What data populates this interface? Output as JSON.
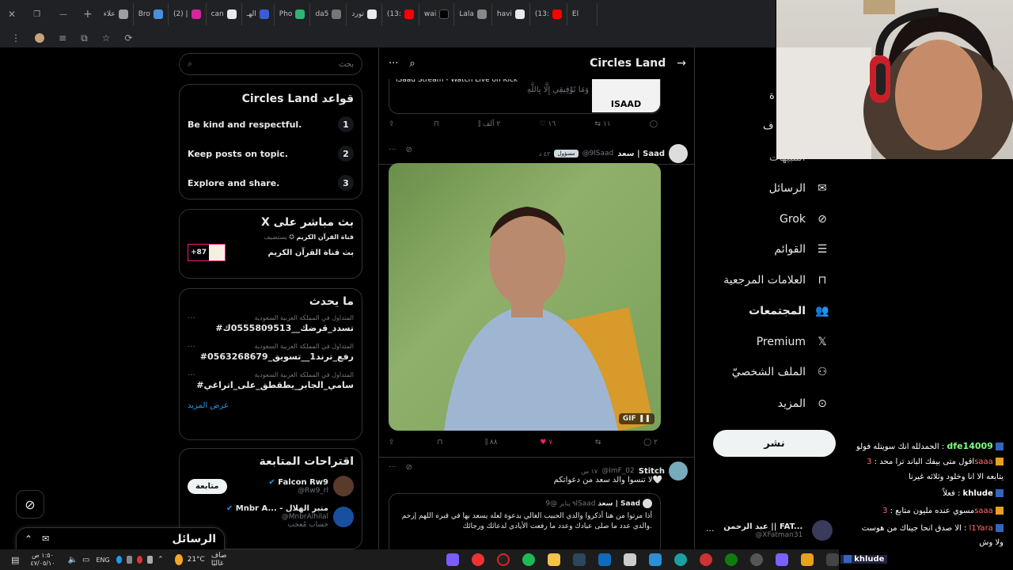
{
  "browser": {
    "tabs": [
      "علاء",
      "Bro",
      "(2) |",
      "can",
      "الهـ",
      "Pho",
      "da5",
      "تورد",
      "(13:",
      "wai",
      "Lala",
      "havi",
      "(13:",
      "El"
    ]
  },
  "search": {
    "placeholder": "بحث"
  },
  "rules": {
    "title": "Circles Land قواعد",
    "items": [
      {
        "n": "1",
        "text": "Be kind and respectful."
      },
      {
        "n": "2",
        "text": "Keep posts on topic."
      },
      {
        "n": "3",
        "text": "Explore and share."
      }
    ]
  },
  "live": {
    "title": "X بث مباشر على",
    "host_prefix": "يستضيف",
    "host": "قناة القرآن الكريم",
    "stream": "بث قناة القرآن الكريم",
    "listeners": "+87"
  },
  "trends": {
    "title": "ما يحدث",
    "items": [
      {
        "cat": "المتداول في المملكة العربية السعودية",
        "tag": "#تسدد_قرضك__0555809513ك"
      },
      {
        "cat": "المتداول في المملكة العربية السعودية",
        "tag": "#رفع_ترند1__تسويق_0563268679"
      },
      {
        "cat": "المتداول في المملكة العربية السعودية",
        "tag": "#سامي_الجابر_يطقطق_على_اتراغي"
      }
    ],
    "more": "عرض المزيد"
  },
  "suggestions": {
    "title": "اقتراحات المتابعة",
    "items": [
      {
        "name": "Falcon Rw9",
        "handle": "@Rw9_rl",
        "button": "متابعة"
      },
      {
        "name": "Mnbr A... - منبر الهلال",
        "handle": "@MnbrAlhilal",
        "sub": "حساب مُعجب"
      }
    ]
  },
  "messages_bar": {
    "label": "الرسائل"
  },
  "feed": {
    "header_title": "Circles Land",
    "post1": {
      "card_text": "iSaad Stream - Watch Live on Kick",
      "quote": "وَمَا تَوْفِيقِي إِلَّا بِاللَّهِ",
      "thumb_label": "ISAAD",
      "replies": "",
      "reposts": "١١",
      "likes": "١٦",
      "views": "٢ ألف"
    },
    "post2": {
      "name": "سعد | Saad",
      "handle": "@9lSaad",
      "badge": "مسؤول",
      "time": "٤٢ د",
      "gif_label": "GIF",
      "replies": "٢",
      "likes": "٧",
      "views": "٨٨"
    },
    "post3": {
      "name": "Stitch",
      "handle": "@ImF_02",
      "time": "١٧ س",
      "text": "لا تنسوا والد سعد من دعواتكم🤍",
      "quoted": {
        "name": "سعد | Saad",
        "handle": "@9lSaad",
        "time": "٩ يناير",
        "text": "أذا مرتوا من هنا أذكروا والدي الحبيب الغالي بدعوة لعله يسعد بها في قبره اللهم إرحم والدي عدد ما صلى عبادك وعدد ما رفعت الأيادي لدعائك ورجائك."
      }
    }
  },
  "nav": {
    "items": [
      {
        "label": "الرسائل",
        "icon": "mail-icon"
      },
      {
        "label": "Grok",
        "icon": "grok-icon"
      },
      {
        "label": "القوائم",
        "icon": "list-icon"
      },
      {
        "label": "العلامات المرجعية",
        "icon": "bookmark-icon"
      },
      {
        "label": "المجتمعات",
        "icon": "communities-icon"
      },
      {
        "label": "Premium",
        "icon": "x-icon"
      },
      {
        "label": "الملف الشخصيّ",
        "icon": "profile-icon"
      },
      {
        "label": "المزيد",
        "icon": "more-icon"
      }
    ],
    "post_button": "نشر",
    "account": {
      "name": "عبد الرحمن || FAT...",
      "handle": "@XFatman31"
    }
  },
  "chat": [
    {
      "user": "dfe14009",
      "text": "الحمدلله انك سويتله فولو"
    },
    {
      "user": "",
      "text": "اقول متى بيفك الباند ترا محد"
    },
    {
      "user": "",
      "text": "يتابعه الا انا وخلود وثلاثه غيرنا"
    },
    {
      "user": "khlude",
      "text": "فعلاً"
    },
    {
      "user": "3saaa",
      "text": "مسوي عنده مليون متابع"
    },
    {
      "user": "l1Yara",
      "text": "الا صدق انحا جيناك من هوست"
    },
    {
      "user": "",
      "text": "ولا وش"
    },
    {
      "user": "khlude",
      "text": ""
    }
  ],
  "taskbar": {
    "weather": "21°C",
    "weather_text": "صاف غالبًا",
    "lang": "ENG",
    "time": "١:٥٠ ص",
    "date": "٤٧/٠٥/١٠"
  }
}
